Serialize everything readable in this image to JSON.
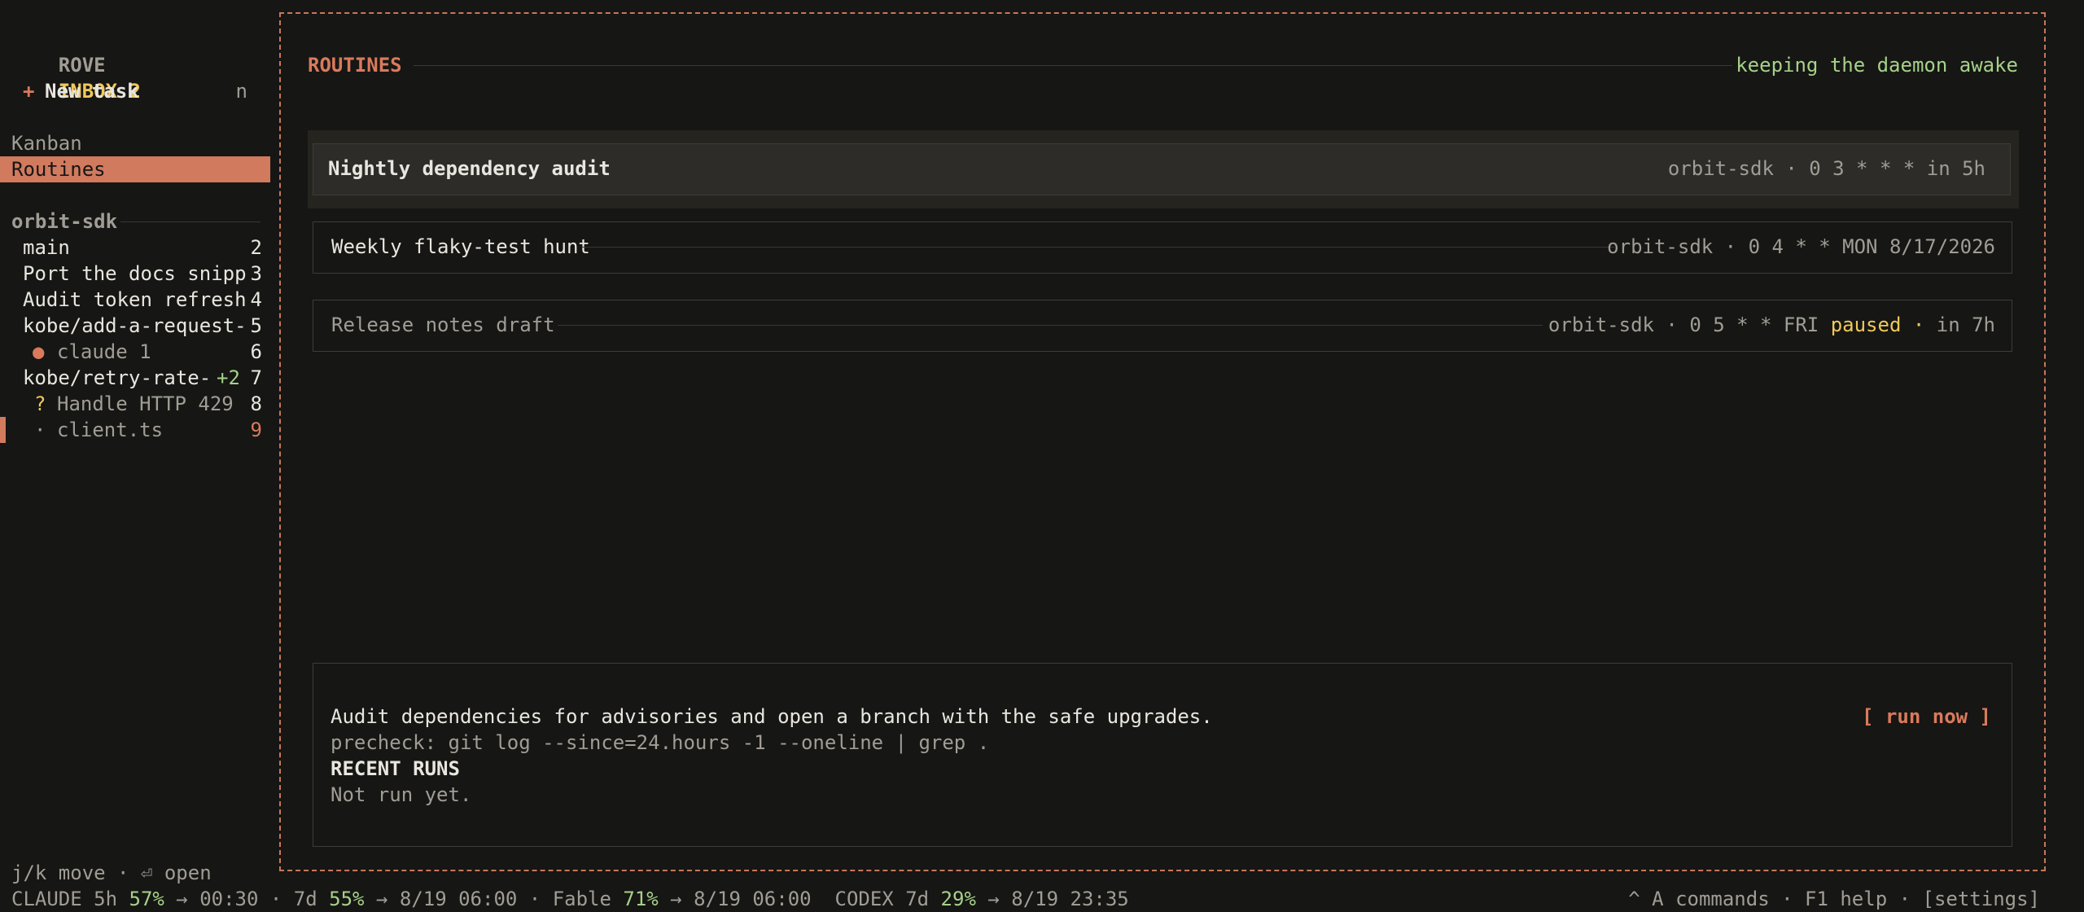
{
  "app": {
    "name": "ROVE",
    "inbox_label": "INBOX 2"
  },
  "sidebar": {
    "new_task": {
      "plus": "+",
      "label": "New task",
      "shortcut": "n"
    },
    "nav": [
      {
        "label": "Kanban"
      },
      {
        "label": "Routines",
        "selected": true
      }
    ],
    "project": "orbit-sdk",
    "items": [
      {
        "prefix": "",
        "label": "main",
        "num": "2"
      },
      {
        "prefix": "",
        "label": "Port the docs snipp",
        "num": "3"
      },
      {
        "prefix": "",
        "label": "Audit token refresh",
        "num": "4"
      },
      {
        "prefix": "",
        "label": "kobe/add-a-request-",
        "num": "5"
      },
      {
        "prefix": "●",
        "label": "claude 1",
        "num": "6"
      },
      {
        "prefix": "",
        "label": "kobe/retry-rate-",
        "extra": "+2",
        "num": "7"
      },
      {
        "prefix": "?",
        "label": "Handle HTTP 429",
        "num": "8"
      },
      {
        "prefix": "·",
        "label": "client.ts",
        "num": "9"
      }
    ],
    "hint": "j/k move · ⏎ open"
  },
  "main": {
    "heading": "ROUTINES",
    "status": "keeping the daemon awake",
    "routines": [
      {
        "title": "Nightly dependency audit",
        "meta": "orbit-sdk · 0 3 * * * in 5h",
        "selected": true
      },
      {
        "title": "Weekly flaky-test hunt",
        "meta": "orbit-sdk · 0 4 * * MON 8/17/2026"
      },
      {
        "title": "Release notes draft",
        "meta_pre": "orbit-sdk · 0 5 * * FRI ",
        "paused": "paused ·",
        "meta_post": " in 7h",
        "dimmed": true
      }
    ],
    "detail": {
      "description": "Audit dependencies for advisories and open a branch with the safe upgrades.",
      "run_now": "[ run now ]",
      "precheck": "precheck: git log --since=24.hours -1 --oneline | grep .",
      "recent_runs_heading": "RECENT RUNS",
      "recent_runs_empty": "Not run yet."
    }
  },
  "statusbar": {
    "claude_label": "CLAUDE 5h ",
    "claude_5h_pct": "57%",
    "claude_5h_reset": " → 00:30 · 7d ",
    "claude_7d_pct": "55%",
    "claude_7d_reset": " → 8/19 06:00 · Fable ",
    "fable_pct": "71%",
    "fable_reset": " → 8/19 06:00  CODEX 7d ",
    "codex_pct": "29%",
    "codex_reset": " → 8/19 23:35",
    "right": "^ A commands · F1 help · [settings]"
  },
  "colors": {
    "accent": "#d27a5e",
    "yellow": "#f0c95c",
    "green": "#a6d18a",
    "bg": "#161614"
  }
}
